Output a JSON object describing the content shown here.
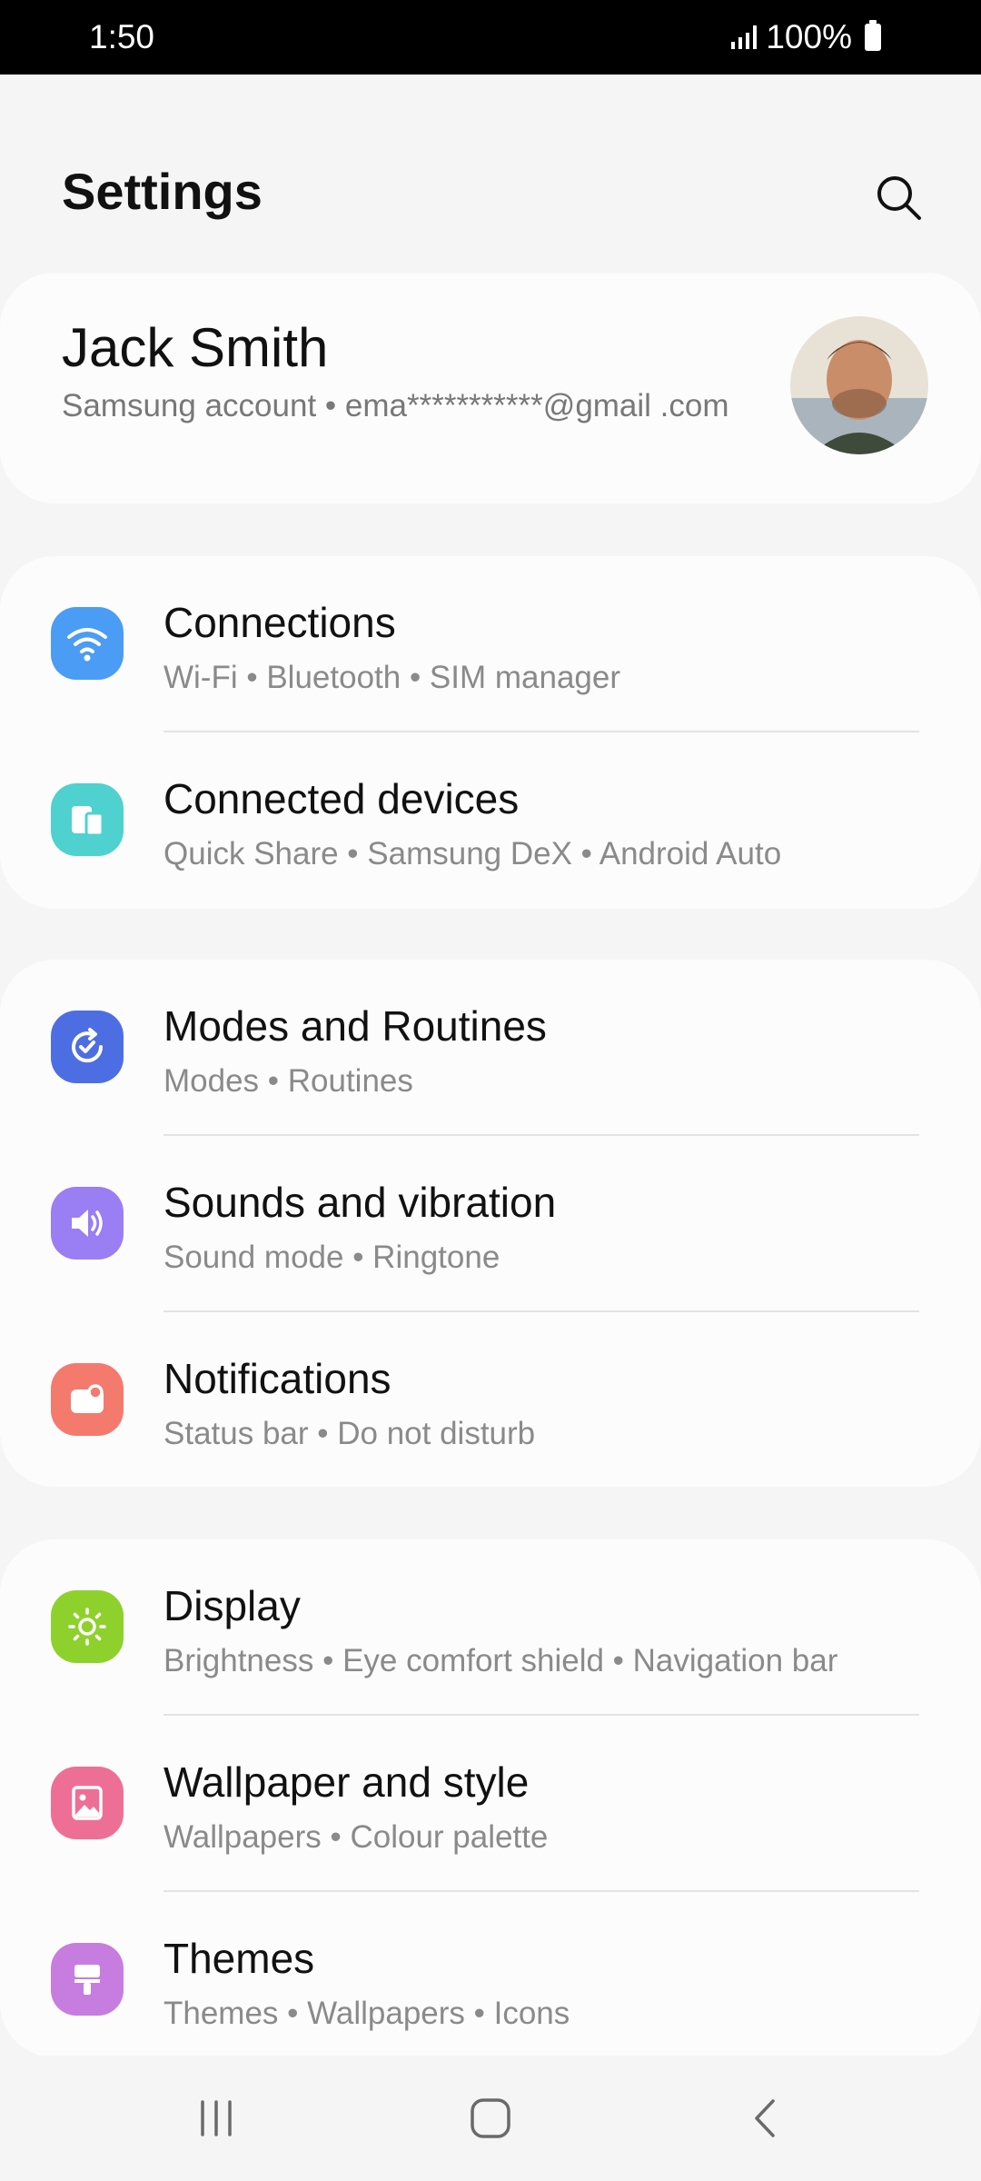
{
  "status_bar": {
    "time": "1:50",
    "battery": "100%"
  },
  "header": {
    "title": "Settings"
  },
  "account": {
    "name": "Jack Smith",
    "subtitle": "Samsung account  •  ema***********@gmail .com"
  },
  "groups": [
    {
      "items": [
        {
          "title": "Connections",
          "subtitle": "Wi-Fi  •  Bluetooth  •  SIM manager",
          "icon": "wifi-icon",
          "color": "#4a9cf5"
        },
        {
          "title": "Connected devices",
          "subtitle": "Quick Share  •  Samsung DeX  •  Android Auto",
          "icon": "devices-icon",
          "color": "#4fd1cf"
        }
      ]
    },
    {
      "items": [
        {
          "title": "Modes and Routines",
          "subtitle": "Modes  •  Routines",
          "icon": "routines-icon",
          "color": "#4d6ee3"
        },
        {
          "title": "Sounds and vibration",
          "subtitle": "Sound mode  •  Ringtone",
          "icon": "sound-icon",
          "color": "#9a7ef3"
        },
        {
          "title": "Notifications",
          "subtitle": "Status bar  •  Do not disturb",
          "icon": "notifications-icon",
          "color": "#f47a6e"
        }
      ]
    },
    {
      "items": [
        {
          "title": "Display",
          "subtitle": "Brightness  •  Eye comfort shield  •  Navigation bar",
          "icon": "brightness-icon",
          "color": "#8ed12c"
        },
        {
          "title": "Wallpaper and style",
          "subtitle": "Wallpapers  •  Colour palette",
          "icon": "wallpaper-icon",
          "color": "#ee6f96"
        },
        {
          "title": "Themes",
          "subtitle": "Themes  •  Wallpapers  •  Icons",
          "icon": "themes-icon",
          "color": "#c77ce0"
        }
      ]
    }
  ]
}
